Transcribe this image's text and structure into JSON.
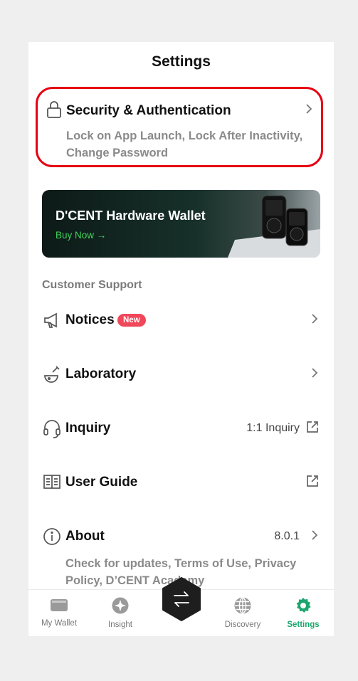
{
  "header": {
    "title": "Settings"
  },
  "security": {
    "title": "Security & Authentication",
    "subtitle": "Lock on App Launch, Lock After Inactivity, Change Password"
  },
  "banner": {
    "title": "D'CENT Hardware Wallet",
    "cta": "Buy Now →"
  },
  "support": {
    "section_label": "Customer Support",
    "notices": {
      "label": "Notices",
      "badge": "New"
    },
    "laboratory": {
      "label": "Laboratory"
    },
    "inquiry": {
      "label": "Inquiry",
      "right_text": "1:1 Inquiry"
    },
    "user_guide": {
      "label": "User Guide"
    },
    "about": {
      "label": "About",
      "version": "8.0.1",
      "subtitle": "Check for updates, Terms of Use, Privacy Policy, D’CENT Academy"
    }
  },
  "tabs": [
    {
      "label": "My Wallet",
      "icon": "wallet-icon"
    },
    {
      "label": "Insight",
      "icon": "insight-icon"
    },
    {
      "label": "",
      "icon": "swap-icon"
    },
    {
      "label": "Discovery",
      "icon": "globe-icon"
    },
    {
      "label": "Settings",
      "icon": "gear-icon",
      "active": true
    }
  ],
  "colors": {
    "accent": "#1aa66e",
    "highlight": "#e60012",
    "badge": "#f0475a",
    "buy_now": "#3fd65a"
  }
}
